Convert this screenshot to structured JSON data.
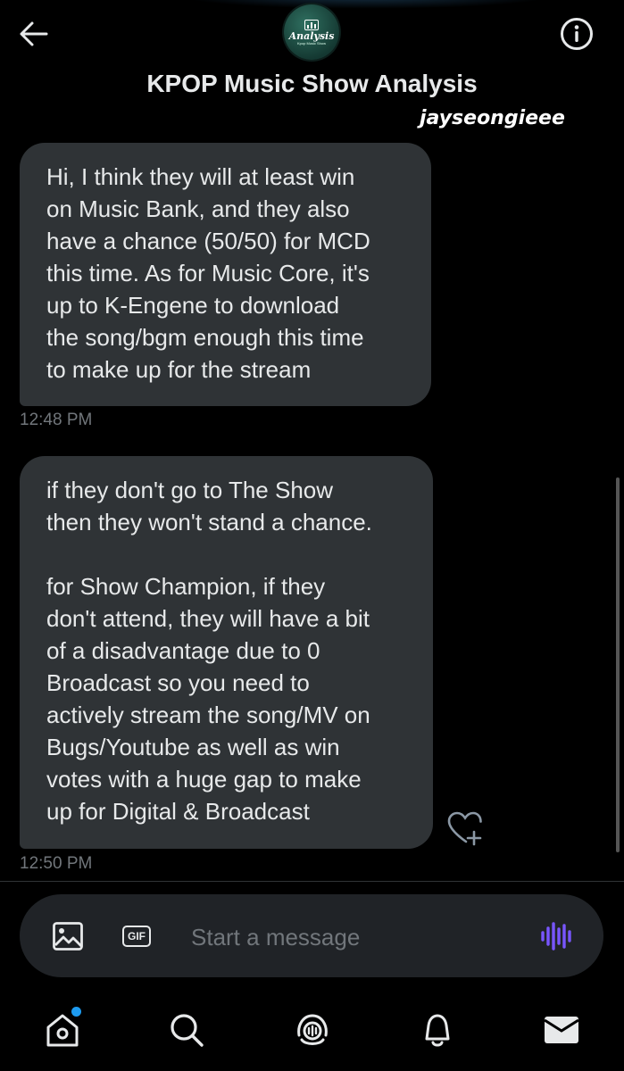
{
  "header": {
    "title": "KPOP Music Show Analysis",
    "avatar_text": "Analysis",
    "avatar_subtext": "Kpop Music Show",
    "watermark": "jayseongieee"
  },
  "messages": [
    {
      "text": "Hi, I think they will at least win\non Music Bank, and they also\nhave a chance (50/50) for MCD\nthis time. As for Music Core, it's\nup to K-Engene to download\nthe song/bgm enough this time\nto make up for the stream",
      "time": "12:48 PM"
    },
    {
      "text": "if they don't go to The Show\nthen they won't stand a chance.\n\nfor Show Champion, if they\ndon't attend, they will have a bit\nof a disadvantage due to 0\nBroadcast so you need to\nactively stream the song/MV on\nBugs/Youtube as well as win\nvotes with a huge gap to make\nup for Digital & Broadcast",
      "time": "12:50 PM"
    }
  ],
  "composer": {
    "placeholder": "Start a message",
    "gif_label": "GIF"
  },
  "icons": {
    "back": "arrow-left-icon",
    "info": "info-icon",
    "react": "heart-plus-icon",
    "image": "image-icon",
    "gif": "gif-icon",
    "voice": "voice-wave-icon",
    "nav": [
      "home-icon",
      "search-icon",
      "spaces-icon",
      "bell-icon",
      "mail-icon"
    ]
  },
  "colors": {
    "background": "#000000",
    "bubble": "#2f3336",
    "accent": "#1d9bf0",
    "voice": "#7856ff",
    "timestamp": "#71767b"
  }
}
